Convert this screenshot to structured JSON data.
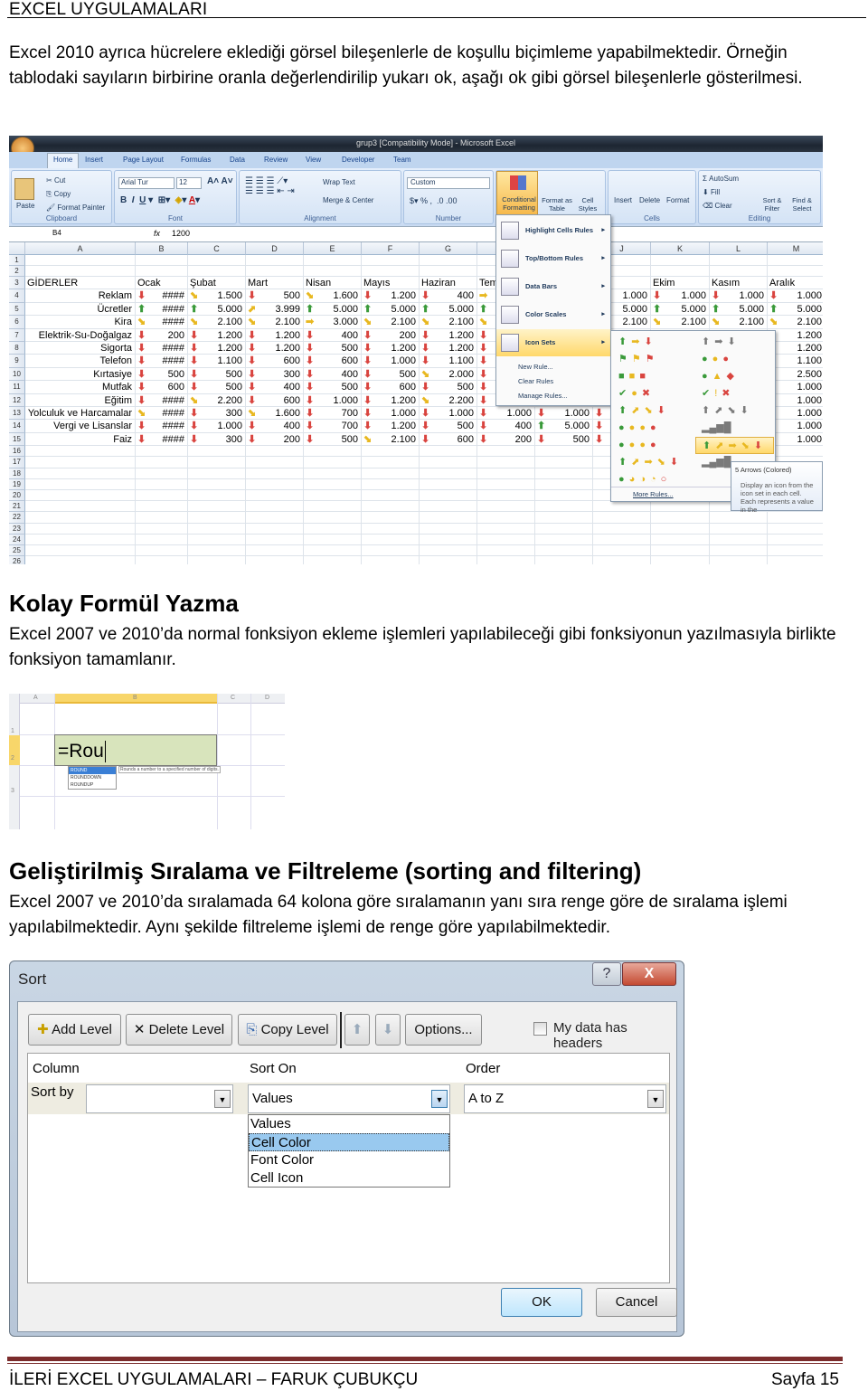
{
  "header": {
    "title": "EXCEL UYGULAMALARI"
  },
  "intro": {
    "text": "Excel 2010 ayrıca hücrelere eklediği görsel bileşenlerle de koşullu biçimleme yapabilmektedir. Örneğin tablodaki sayıların birbirine oranla değerlendirilip yukarı ok, aşağı ok gibi görsel bileşenlerle gösterilmesi."
  },
  "excel1": {
    "window_title": "grup3 [Compatibility Mode] - Microsoft Excel",
    "tabs": [
      "Home",
      "Insert",
      "Page Layout",
      "Formulas",
      "Data",
      "Review",
      "View",
      "Developer",
      "Team"
    ],
    "ribbon": {
      "clipboard": {
        "label": "Clipboard",
        "paste": "Paste",
        "cut": "Cut",
        "copy": "Copy",
        "format_painter": "Format Painter"
      },
      "font": {
        "label": "Font",
        "font_name": "Arial Tur",
        "font_size": "12"
      },
      "alignment": {
        "label": "Alignment",
        "wrap": "Wrap Text",
        "merge": "Merge & Center"
      },
      "number": {
        "label": "Number",
        "format": "Custom"
      },
      "styles": {
        "conditional": "Conditional Formatting",
        "format_table": "Format as Table",
        "cell_styles": "Cell Styles"
      },
      "cells": {
        "label": "Cells",
        "insert": "Insert",
        "delete": "Delete",
        "format": "Format"
      },
      "editing": {
        "label": "Editing",
        "autosum": "AutoSum",
        "fill": "Fill",
        "clear": "Clear",
        "sort": "Sort & Filter",
        "find": "Find & Select"
      }
    },
    "formula_bar": {
      "name_box": "B4",
      "fx": "fx",
      "value": "1200"
    },
    "columns": [
      "A",
      "B",
      "C",
      "D",
      "E",
      "F",
      "G",
      "H",
      "I",
      "J",
      "K",
      "L",
      "M"
    ],
    "header_row": [
      "GİDERLER",
      "Ocak",
      "Şubat",
      "Mart",
      "Nisan",
      "Mayıs",
      "Haziran",
      "Tem",
      "",
      "",
      "Ekim",
      "Kasım",
      "Aralık"
    ],
    "rows": [
      {
        "label": "Reklam",
        "cells": [
          [
            "down",
            "####"
          ],
          [
            "diag",
            "1.500"
          ],
          [
            "down",
            "500"
          ],
          [
            "diag",
            "1.600"
          ],
          [
            "down",
            "1.200"
          ],
          [
            "down",
            "400"
          ],
          [
            "right",
            ""
          ],
          [
            "",
            ""
          ],
          [
            "",
            "1.000"
          ],
          [
            "down",
            "1.000"
          ],
          [
            "down",
            "1.000"
          ],
          [
            "down",
            "1.000"
          ]
        ]
      },
      {
        "label": "Ücretler",
        "cells": [
          [
            "up",
            "####"
          ],
          [
            "up",
            "5.000"
          ],
          [
            "upright",
            "3.999"
          ],
          [
            "up",
            "5.000"
          ],
          [
            "up",
            "5.000"
          ],
          [
            "up",
            "5.000"
          ],
          [
            "up",
            ""
          ],
          [
            "",
            ""
          ],
          [
            "",
            "5.000"
          ],
          [
            "up",
            "5.000"
          ],
          [
            "up",
            "5.000"
          ],
          [
            "up",
            "5.000"
          ]
        ]
      },
      {
        "label": "Kira",
        "cells": [
          [
            "diag",
            "####"
          ],
          [
            "diag",
            "2.100"
          ],
          [
            "diag",
            "2.100"
          ],
          [
            "right",
            "3.000"
          ],
          [
            "diag",
            "2.100"
          ],
          [
            "diag",
            "2.100"
          ],
          [
            "diag",
            ""
          ],
          [
            "",
            ""
          ],
          [
            "",
            "2.100"
          ],
          [
            "diag",
            "2.100"
          ],
          [
            "diag",
            "2.100"
          ],
          [
            "diag",
            "2.100"
          ]
        ]
      },
      {
        "label": "Elektrik-Su-Doğalgaz",
        "cells": [
          [
            "down",
            "200"
          ],
          [
            "down",
            "1.200"
          ],
          [
            "down",
            "1.200"
          ],
          [
            "down",
            "400"
          ],
          [
            "down",
            "200"
          ],
          [
            "down",
            "1.200"
          ],
          [
            "down",
            ""
          ],
          [
            "",
            ""
          ],
          [
            "",
            ""
          ],
          [
            "",
            ""
          ],
          [
            "",
            ""
          ],
          [
            "",
            "1.200"
          ]
        ]
      },
      {
        "label": "Sigorta",
        "cells": [
          [
            "down",
            "####"
          ],
          [
            "down",
            "1.200"
          ],
          [
            "down",
            "1.200"
          ],
          [
            "down",
            "500"
          ],
          [
            "down",
            "1.200"
          ],
          [
            "down",
            "1.200"
          ],
          [
            "down",
            ""
          ],
          [
            "",
            ""
          ],
          [
            "",
            ""
          ],
          [
            "",
            ""
          ],
          [
            "",
            ""
          ],
          [
            "",
            "1.200"
          ]
        ]
      },
      {
        "label": "Telefon",
        "cells": [
          [
            "down",
            "####"
          ],
          [
            "down",
            "1.100"
          ],
          [
            "down",
            "600"
          ],
          [
            "down",
            "600"
          ],
          [
            "down",
            "1.000"
          ],
          [
            "down",
            "1.100"
          ],
          [
            "down",
            ""
          ],
          [
            "",
            ""
          ],
          [
            "",
            ""
          ],
          [
            "",
            ""
          ],
          [
            "",
            ""
          ],
          [
            "",
            "1.100"
          ]
        ]
      },
      {
        "label": "Kırtasiye",
        "cells": [
          [
            "down",
            "500"
          ],
          [
            "down",
            "500"
          ],
          [
            "down",
            "300"
          ],
          [
            "down",
            "400"
          ],
          [
            "down",
            "500"
          ],
          [
            "diag",
            "2.000"
          ],
          [
            "down",
            ""
          ],
          [
            "",
            ""
          ],
          [
            "",
            ""
          ],
          [
            "",
            ""
          ],
          [
            "",
            ""
          ],
          [
            "",
            "2.500"
          ]
        ]
      },
      {
        "label": "Mutfak",
        "cells": [
          [
            "down",
            "600"
          ],
          [
            "down",
            "500"
          ],
          [
            "down",
            "400"
          ],
          [
            "down",
            "500"
          ],
          [
            "down",
            "600"
          ],
          [
            "down",
            "500"
          ],
          [
            "down",
            ""
          ],
          [
            "",
            ""
          ],
          [
            "",
            ""
          ],
          [
            "",
            ""
          ],
          [
            "",
            ""
          ],
          [
            "",
            "1.000"
          ]
        ]
      },
      {
        "label": "Eğitim",
        "cells": [
          [
            "down",
            "####"
          ],
          [
            "diag",
            "2.200"
          ],
          [
            "down",
            "600"
          ],
          [
            "down",
            "1.000"
          ],
          [
            "down",
            "1.200"
          ],
          [
            "diag",
            "2.200"
          ],
          [
            "down",
            ""
          ],
          [
            "",
            ""
          ],
          [
            "",
            ""
          ],
          [
            "",
            ""
          ],
          [
            "",
            ""
          ],
          [
            "",
            "1.000"
          ]
        ]
      },
      {
        "label": "Yolculuk ve Harcamalar",
        "cells": [
          [
            "diag",
            "####"
          ],
          [
            "down",
            "300"
          ],
          [
            "diag",
            "1.600"
          ],
          [
            "down",
            "700"
          ],
          [
            "down",
            "1.000"
          ],
          [
            "down",
            "1.000"
          ],
          [
            "down",
            "1.000"
          ],
          [
            "down",
            "1.000"
          ],
          [
            "down",
            ""
          ],
          [
            "",
            ""
          ],
          [
            "",
            ""
          ],
          [
            "",
            "1.000"
          ]
        ]
      },
      {
        "label": "Vergi ve Lisanslar",
        "cells": [
          [
            "down",
            "####"
          ],
          [
            "down",
            "1.000"
          ],
          [
            "down",
            "400"
          ],
          [
            "down",
            "700"
          ],
          [
            "down",
            "1.200"
          ],
          [
            "down",
            "500"
          ],
          [
            "down",
            "400"
          ],
          [
            "up",
            "5.000"
          ],
          [
            "down",
            ""
          ],
          [
            "",
            ""
          ],
          [
            "",
            ""
          ],
          [
            "",
            "1.000"
          ]
        ]
      },
      {
        "label": "Faiz",
        "cells": [
          [
            "down",
            "####"
          ],
          [
            "down",
            "300"
          ],
          [
            "down",
            "200"
          ],
          [
            "down",
            "500"
          ],
          [
            "diag",
            "2.100"
          ],
          [
            "down",
            "600"
          ],
          [
            "down",
            "200"
          ],
          [
            "down",
            "500"
          ],
          [
            "down",
            ""
          ],
          [
            "",
            ""
          ],
          [
            "",
            ""
          ],
          [
            "",
            "1.000"
          ]
        ]
      }
    ],
    "cf_menu": [
      "Highlight Cells Rules",
      "Top/Bottom Rules",
      "Data Bars",
      "Color Scales",
      "Icon Sets"
    ],
    "cf_menu_small": [
      "New Rule...",
      "Clear Rules",
      "Manage Rules..."
    ],
    "icon_sets_left": [
      "⬆ ➡ ⬇",
      "⚑ ⚑ ⚑",
      "■ ■ ■",
      "✔ ● ✖",
      "⬆ ⬈ ⬊ ⬇",
      "● ● ● ●",
      "● ● ● ●",
      "⬆ ⬈ ➡ ⬊ ⬇",
      "● ◕ ◑ ◔ ○"
    ],
    "icon_sets_right": [
      "⬆ ➡ ⬇",
      "● ● ●",
      "● ▲ ◆",
      "✔ ! ✖",
      "⬆ ⬈ ⬊ ⬇",
      "▂▄▆█",
      "⬆ ⬈ ➡ ⬊ ⬇",
      "▂▄▆█"
    ],
    "more_rules": "More Rules...",
    "tooltip": {
      "title": "5 Arrows (Colored)",
      "body": "Display an icon from the icon set in each cell. Each represents a value in the"
    }
  },
  "section2": {
    "title": "Kolay Formül Yazma",
    "text": "Excel 2007 ve 2010’da normal fonksiyon ekleme işlemleri yapılabileceği gibi fonksiyonun yazılmasıyla birlikte fonksiyon tamamlanır."
  },
  "excel2": {
    "columns": [
      "A",
      "B",
      "C",
      "D"
    ],
    "rows": [
      "1",
      "2",
      "3"
    ],
    "formula": "=Rou",
    "suggestions": [
      "ROUND",
      "ROUNDDOWN",
      "ROUNDUP"
    ],
    "tooltip": "Rounds a number to a specified number of digits."
  },
  "section3": {
    "title": "Geliştirilmiş Sıralama ve Filtreleme (sorting and filtering)",
    "text": "Excel 2007 ve 2010’da sıralamada 64 kolona göre sıralamanın yanı sıra renge göre de sıralama işlemi yapılabilmektedir. Aynı şekilde filtreleme işlemi de renge göre yapılabilmektedir."
  },
  "sort_dialog": {
    "title": "Sort",
    "help": "?",
    "close": "X",
    "add_level": "Add Level",
    "delete_level": "Delete Level",
    "copy_level": "Copy Level",
    "options": "Options...",
    "headers_checkbox": "My data has headers",
    "headers_checked": false,
    "col_header": "Column",
    "sorton_header": "Sort On",
    "order_header": "Order",
    "sort_by": "Sort by",
    "column_value": "",
    "sort_on_value": "Values",
    "order_value": "A to Z",
    "sort_on_options": [
      "Values",
      "Cell Color",
      "Font Color",
      "Cell Icon"
    ],
    "highlighted_option": "Cell Color",
    "ok": "OK",
    "cancel": "Cancel"
  },
  "footer": {
    "left": "İLERİ EXCEL UYGULAMALARI – FARUK ÇUBUKÇU",
    "right": "Sayfa 15"
  },
  "colors": {
    "arrow_down": "#d9443f",
    "arrow_up": "#3a9a3a",
    "arrow_mid": "#e8b820",
    "footer_rule": "#7b2c2c"
  }
}
